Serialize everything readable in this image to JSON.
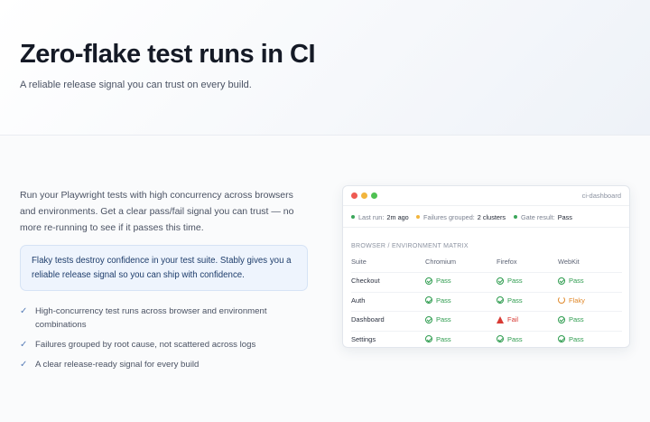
{
  "hero": {
    "title": "Zero-flake test runs in CI",
    "subtitle": "A reliable release signal you can trust on every build."
  },
  "intro": "Run your Playwright tests with high concurrency across browsers and environments. Get a clear pass/fail signal you can trust — no more re-running to see if it passes this time.",
  "callout": "Flaky tests destroy confidence in your test suite. Stably gives you a reliable release signal so you can ship with confidence.",
  "features": [
    "High-concurrency test runs across browser and environment combinations",
    "Failures grouped by root cause, not scattered across logs",
    "A clear release-ready signal for every build"
  ],
  "dashboard": {
    "title": "ci-dashboard",
    "stats": [
      {
        "label": "Last run:",
        "value": "2m ago",
        "color": "#3aa65a"
      },
      {
        "label": "Failures grouped:",
        "value": "2 clusters",
        "color": "#f2b53c"
      },
      {
        "label": "Gate result:",
        "value": "Pass",
        "color": "#3aa65a"
      }
    ],
    "matrix_title": "BROWSER / ENVIRONMENT MATRIX",
    "columns": [
      "Suite",
      "Chromium",
      "Firefox",
      "WebKit"
    ],
    "rows": [
      {
        "suite": "Checkout",
        "chromium": "Pass",
        "firefox": "Pass",
        "webkit": "Pass"
      },
      {
        "suite": "Auth",
        "chromium": "Pass",
        "firefox": "Pass",
        "webkit": "Flaky"
      },
      {
        "suite": "Dashboard",
        "chromium": "Pass",
        "firefox": "Fail",
        "webkit": "Pass"
      },
      {
        "suite": "Settings",
        "chromium": "Pass",
        "firefox": "Pass",
        "webkit": "Pass"
      }
    ]
  },
  "colors": {
    "pass": "#2e9c4f",
    "fail": "#d83a34",
    "flaky": "#e0892b",
    "callout_bg": "#eef4fd"
  }
}
